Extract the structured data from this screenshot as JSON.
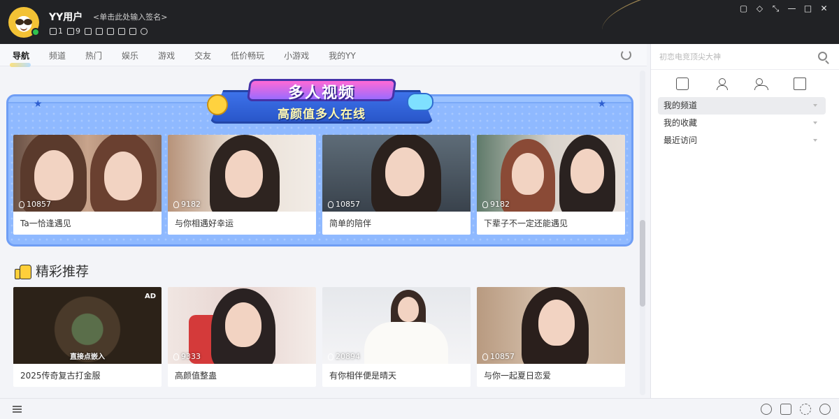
{
  "user": {
    "name": "YY用户",
    "signature": "<单击此处输入签名>",
    "badge_count_1": "1",
    "badge_count_2": "9"
  },
  "window_controls": [
    "feedback-icon",
    "skin-icon",
    "minimize-panel-icon",
    "minimize-icon",
    "maximize-icon",
    "close-icon"
  ],
  "nav": {
    "tabs": [
      "导航",
      "频道",
      "热门",
      "娱乐",
      "游戏",
      "交友",
      "低价畅玩",
      "小游戏",
      "我的YY"
    ]
  },
  "banner": {
    "title": "多人视频",
    "subtitle": "高颜值多人在线",
    "cards": [
      {
        "views": "10857",
        "title": "Ta一恰逢遇见"
      },
      {
        "views": "9182",
        "title": "与你相遇好幸运"
      },
      {
        "views": "10857",
        "title": "简单的陪伴"
      },
      {
        "views": "9182",
        "title": "下辈子不一定还能遇见"
      }
    ]
  },
  "recommend": {
    "heading": "精彩推荐",
    "cards": [
      {
        "views": "",
        "title": "2025传奇复古打金服",
        "ad_label": "AD",
        "cta": "直接点嵌入",
        "is_ad": true
      },
      {
        "views": "9333",
        "title": "高颜值整蛊"
      },
      {
        "views": "20894",
        "title": "有你相伴便是晴天"
      },
      {
        "views": "10857",
        "title": "与你一起夏日恋爱"
      }
    ]
  },
  "sidebar": {
    "search_placeholder": "初恋电竞顶尖大神",
    "items": [
      {
        "label": "我的频道"
      },
      {
        "label": "我的收藏"
      },
      {
        "label": "最近访问"
      }
    ]
  },
  "colors": {
    "titlebar": "#212225",
    "banner": "#8fb9ff",
    "online": "#2fc24e"
  }
}
